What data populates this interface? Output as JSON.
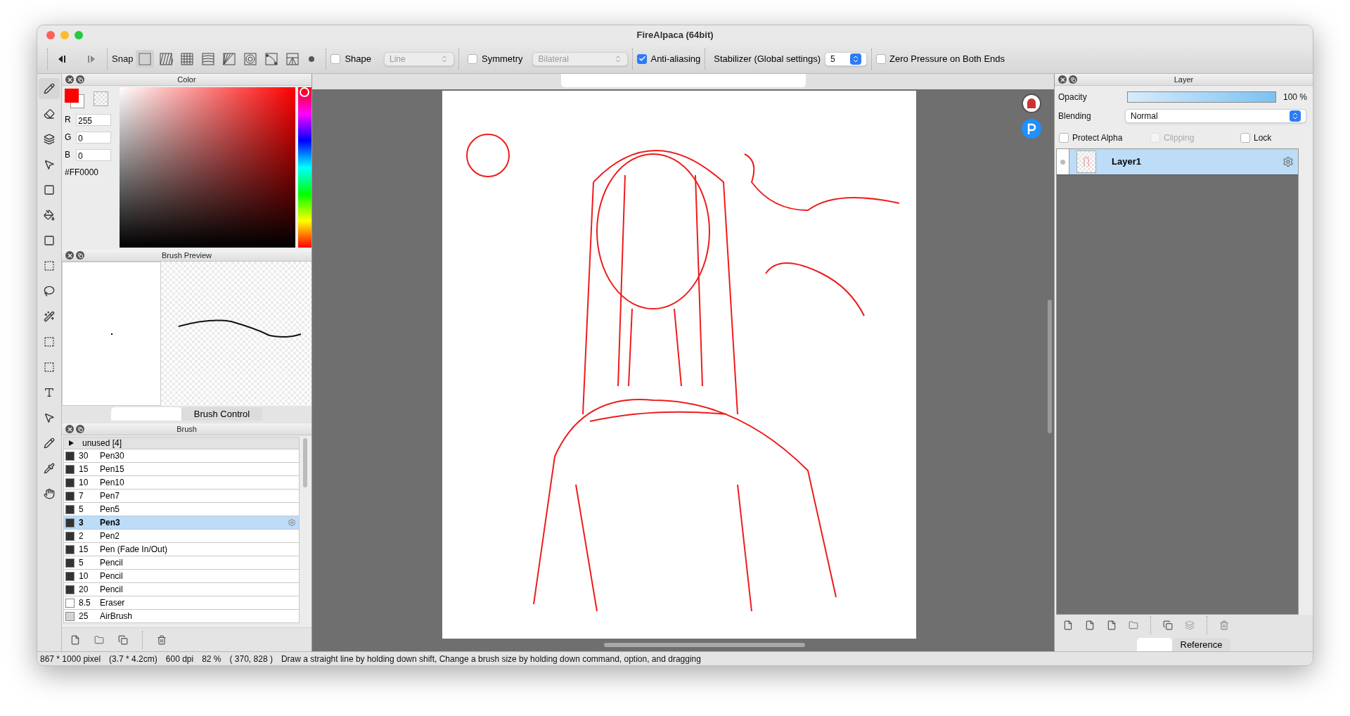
{
  "window": {
    "title": "FireAlpaca (64bit)"
  },
  "toolbar": {
    "snap_label": "Snap",
    "shape": {
      "label": "Shape",
      "checked": false,
      "value": "Line"
    },
    "symmetry": {
      "label": "Symmetry",
      "checked": false,
      "value": "Bilateral"
    },
    "antialias": {
      "label": "Anti-aliasing",
      "checked": true
    },
    "stabilizer": {
      "label": "Stabilizer (Global settings)",
      "value": "5"
    },
    "zero_pressure": {
      "label": "Zero Pressure on Both Ends",
      "checked": false
    }
  },
  "color_panel": {
    "title": "Color",
    "r_label": "R",
    "r": "255",
    "g_label": "G",
    "g": "0",
    "b_label": "B",
    "b": "0",
    "hex": "#FF0000",
    "color": "#ff0000"
  },
  "brush_preview": {
    "title": "Brush Preview",
    "tabs": [
      {
        "label": "Brush Control",
        "selected": false
      }
    ]
  },
  "brush_panel": {
    "title": "Brush",
    "group": {
      "label": "unused [4]",
      "expanded": false
    },
    "items": [
      {
        "size": "30",
        "name": "Pen30",
        "color": "#333333",
        "selected": false
      },
      {
        "size": "15",
        "name": "Pen15",
        "color": "#333333",
        "selected": false
      },
      {
        "size": "10",
        "name": "Pen10",
        "color": "#333333",
        "selected": false
      },
      {
        "size": "7",
        "name": "Pen7",
        "color": "#333333",
        "selected": false
      },
      {
        "size": "5",
        "name": "Pen5",
        "color": "#333333",
        "selected": false
      },
      {
        "size": "3",
        "name": "Pen3",
        "color": "#333333",
        "selected": true
      },
      {
        "size": "2",
        "name": "Pen2",
        "color": "#333333",
        "selected": false
      },
      {
        "size": "15",
        "name": "Pen (Fade In/Out)",
        "color": "#333333",
        "selected": false
      },
      {
        "size": "5",
        "name": "Pencil",
        "color": "#333333",
        "selected": false
      },
      {
        "size": "10",
        "name": "Pencil",
        "color": "#333333",
        "selected": false
      },
      {
        "size": "20",
        "name": "Pencil",
        "color": "#333333",
        "selected": false
      },
      {
        "size": "8.5",
        "name": "Eraser",
        "color": "#ffffff",
        "selected": false
      },
      {
        "size": "25",
        "name": "AirBrush",
        "color": "#d4d4d4",
        "selected": false
      }
    ]
  },
  "layer_panel": {
    "title": "Layer",
    "opacity_label": "Opacity",
    "opacity": {
      "level": 1
    },
    "opacity_reading": "100 %",
    "blending_label": "Blending",
    "blending": "Normal",
    "options": [
      {
        "label": "Protect Alpha",
        "checked": false,
        "disabled": false
      },
      {
        "label": "Clipping",
        "checked": false,
        "disabled": true
      },
      {
        "label": "Lock",
        "checked": false,
        "disabled": false
      }
    ],
    "layers": [
      {
        "name": "Layer1",
        "selected": true
      }
    ],
    "tabs": [
      {
        "label": "Reference",
        "selected": false
      }
    ]
  },
  "status_bar": {
    "size": "867 * 1000 pixel",
    "physical": "(3.7 * 4.2cm)",
    "dpi": "600 dpi",
    "zoom": "82 %",
    "position": "( 370, 828 )",
    "hint": "Draw a straight line by holding down shift, Change a brush size by holding down command, option, and dragging"
  }
}
